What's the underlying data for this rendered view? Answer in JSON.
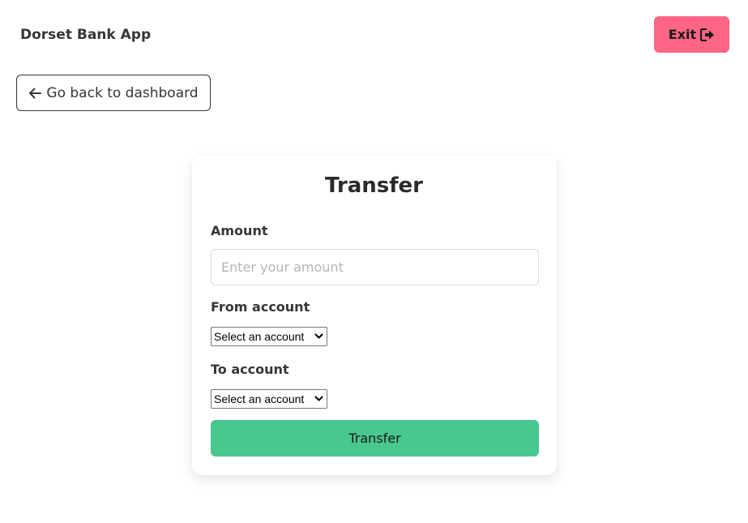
{
  "header": {
    "brand": "Dorset Bank App",
    "exit_label": "Exit",
    "exit_icon": "sign-out-icon",
    "exit_color": "#ff6685"
  },
  "nav": {
    "back_label": "Go back to dashboard",
    "back_icon": "arrow-left-icon"
  },
  "form": {
    "title": "Transfer",
    "amount_label": "Amount",
    "amount_placeholder": "Enter your amount",
    "amount_value": "",
    "from_label": "From account",
    "from_selected": "Select an account",
    "to_label": "To account",
    "to_selected": "Select an account",
    "submit_label": "Transfer",
    "submit_color": "#48c78e"
  }
}
